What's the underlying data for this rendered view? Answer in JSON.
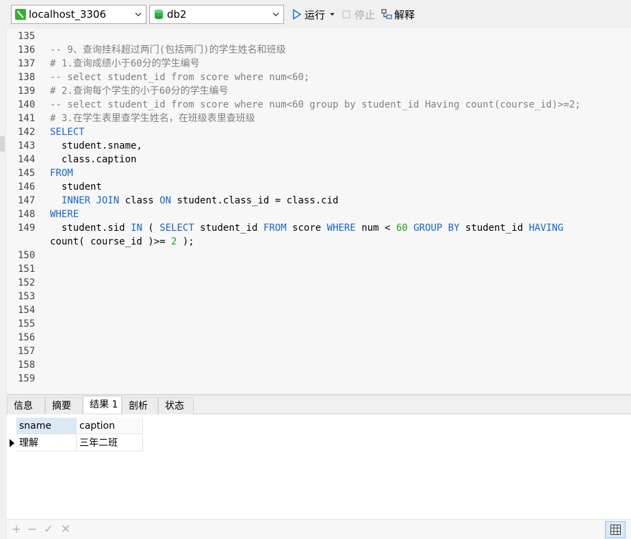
{
  "toolbar": {
    "connection": "localhost_3306",
    "database": "db2",
    "run_label": "运行",
    "stop_label": "停止",
    "explain_label": "解释",
    "colors": {
      "accent": "#1565d8",
      "connection_icon": "#35b030",
      "db_icon": "#2db84a"
    }
  },
  "editor": {
    "lines": [
      {
        "num": "135",
        "tokens": []
      },
      {
        "num": "136",
        "tokens": [
          {
            "t": "-- 9、查询挂科超过两门(包括两门)的学生姓名和班级",
            "c": "cm"
          }
        ]
      },
      {
        "num": "137",
        "tokens": [
          {
            "t": "# 1.查询成绩小于60分的学生编号",
            "c": "cm"
          }
        ]
      },
      {
        "num": "138",
        "tokens": [
          {
            "t": "-- select student_id from score where num<60;",
            "c": "cm"
          }
        ]
      },
      {
        "num": "139",
        "tokens": [
          {
            "t": "# 2.查询每个学生的小于60分的学生编号",
            "c": "cm"
          }
        ]
      },
      {
        "num": "140",
        "tokens": [
          {
            "t": "-- select student_id from score where num<60 group by student_id Having count(course_id)>=2;",
            "c": "cm"
          }
        ]
      },
      {
        "num": "141",
        "tokens": [
          {
            "t": "# 3.在学生表里查学生姓名，在班级表里查班级",
            "c": "cm"
          }
        ]
      },
      {
        "num": "142",
        "tokens": [
          {
            "t": "SELECT",
            "c": "kw"
          }
        ]
      },
      {
        "num": "143",
        "tokens": [
          {
            "t": "  student.sname,",
            "c": "pl"
          }
        ]
      },
      {
        "num": "144",
        "tokens": [
          {
            "t": "  class.caption",
            "c": "pl"
          }
        ]
      },
      {
        "num": "145",
        "tokens": [
          {
            "t": "FROM",
            "c": "kw"
          }
        ]
      },
      {
        "num": "146",
        "tokens": [
          {
            "t": "  student",
            "c": "pl"
          }
        ]
      },
      {
        "num": "147",
        "tokens": [
          {
            "t": "  ",
            "c": "pl"
          },
          {
            "t": "INNER JOIN",
            "c": "kw"
          },
          {
            "t": " class ",
            "c": "pl"
          },
          {
            "t": "ON",
            "c": "kw"
          },
          {
            "t": " student.class_id = class.cid",
            "c": "pl"
          }
        ]
      },
      {
        "num": "148",
        "tokens": [
          {
            "t": "WHERE",
            "c": "kw"
          }
        ]
      },
      {
        "num": "149",
        "tokens": [
          {
            "t": "  student.sid ",
            "c": "pl"
          },
          {
            "t": "IN",
            "c": "kw"
          },
          {
            "t": " ( ",
            "c": "pl"
          },
          {
            "t": "SELECT",
            "c": "kw"
          },
          {
            "t": " student_id ",
            "c": "pl"
          },
          {
            "t": "FROM",
            "c": "kw"
          },
          {
            "t": " score ",
            "c": "pl"
          },
          {
            "t": "WHERE",
            "c": "kw"
          },
          {
            "t": " num < ",
            "c": "pl"
          },
          {
            "t": "60",
            "c": "num"
          },
          {
            "t": " ",
            "c": "pl"
          },
          {
            "t": "GROUP BY",
            "c": "kw"
          },
          {
            "t": " student_id ",
            "c": "pl"
          },
          {
            "t": "HAVING",
            "c": "kw"
          }
        ]
      },
      {
        "num": "",
        "tokens": [
          {
            "t": "count( course_id )>= ",
            "c": "pl"
          },
          {
            "t": "2",
            "c": "num"
          },
          {
            "t": " );",
            "c": "pl"
          }
        ]
      },
      {
        "num": "150",
        "tokens": []
      },
      {
        "num": "151",
        "tokens": []
      },
      {
        "num": "152",
        "tokens": []
      },
      {
        "num": "153",
        "tokens": []
      },
      {
        "num": "154",
        "tokens": []
      },
      {
        "num": "155",
        "tokens": []
      },
      {
        "num": "156",
        "tokens": []
      },
      {
        "num": "157",
        "tokens": []
      },
      {
        "num": "158",
        "tokens": []
      },
      {
        "num": "159",
        "tokens": []
      }
    ]
  },
  "result": {
    "tabs": [
      "信息",
      "摘要",
      "结果 1",
      "剖析",
      "状态"
    ],
    "active_tab": "结果 1",
    "columns": [
      "sname",
      "caption"
    ],
    "rows": [
      [
        "理解",
        "三年二班"
      ]
    ]
  },
  "statusbar": {
    "add": "+",
    "remove": "−",
    "apply": "✓",
    "discard": "✕"
  }
}
